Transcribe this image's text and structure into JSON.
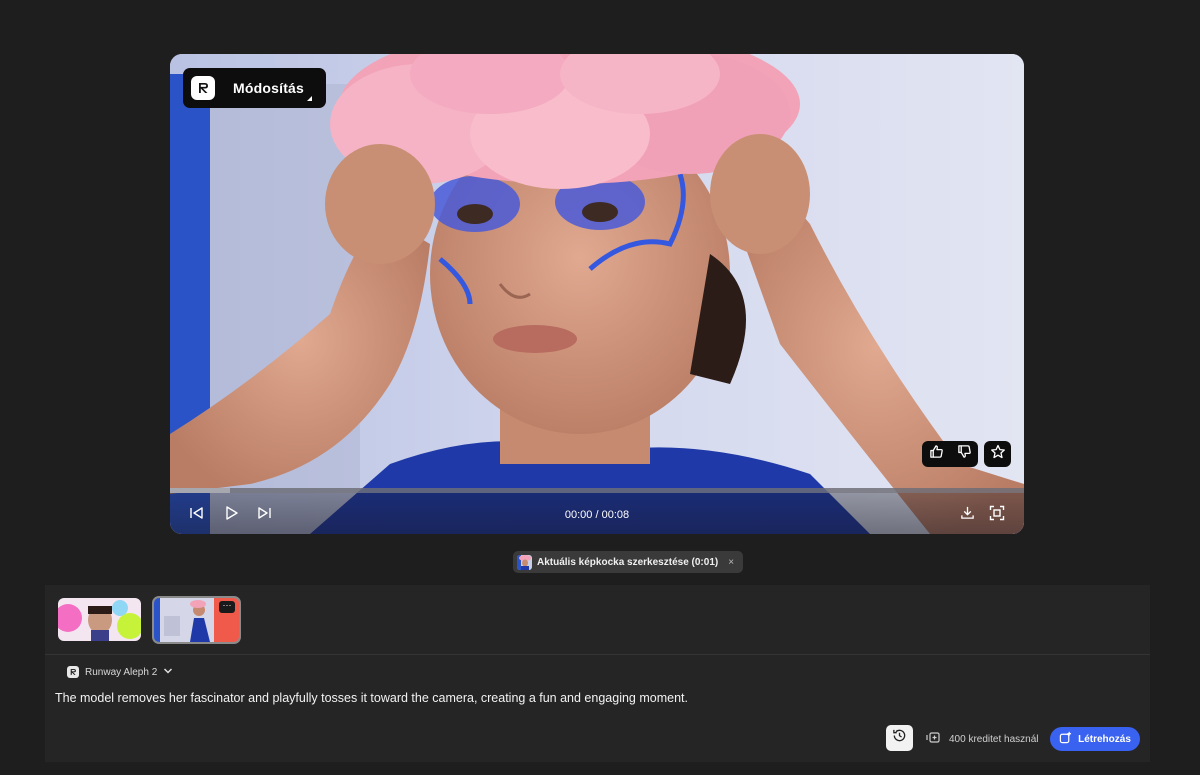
{
  "player": {
    "model_badge_label": "Módosítás",
    "time_current": "00:00",
    "time_total": "00:08",
    "progress": 0.07
  },
  "chip": {
    "label": "Aktuális képkocka szerkesztése (0:01)",
    "close_glyph": "×"
  },
  "reference_thumbnails": [
    {
      "name": "reference-image-1"
    },
    {
      "name": "reference-image-2",
      "more_glyph": "···"
    }
  ],
  "model_select": {
    "label": "Runway Aleph 2"
  },
  "prompt": {
    "text": "The model removes her fascinator and playfully tosses it toward the camera, creating a fun and engaging moment."
  },
  "credits": {
    "label": "400 kreditet használ"
  },
  "create_button": {
    "label": "Létrehozás"
  },
  "icons": {
    "logo": "runway-logo-icon",
    "thumbs_up": "thumbs-up-icon",
    "thumbs_down": "thumbs-down-icon",
    "star": "star-icon",
    "skip_back": "skip-back-icon",
    "play": "play-icon",
    "skip_forward": "skip-forward-icon",
    "download": "download-icon",
    "fullscreen": "fullscreen-icon",
    "history": "history-icon",
    "credits": "credits-icon",
    "create": "create-icon",
    "chevron": "chevron-down-icon"
  },
  "colors": {
    "background": "#1e1e1e",
    "panel": "#252525",
    "accent": "#3a62f0"
  }
}
